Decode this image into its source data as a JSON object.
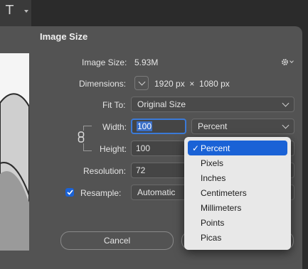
{
  "toolbar": {
    "type_tool_icon": "text-tool-icon",
    "type_tool_glyph": "T"
  },
  "dialog": {
    "title": "Image Size",
    "image_size_label": "Image Size:",
    "image_size_value": "5.93M",
    "dimensions_label": "Dimensions:",
    "dimensions_value": "1920 px  ×  1080 px",
    "fit_to_label": "Fit To:",
    "fit_to_value": "Original Size",
    "width_label": "Width:",
    "width_value": "100",
    "width_unit": "Percent",
    "height_label": "Height:",
    "height_value": "100",
    "resolution_label": "Resolution:",
    "resolution_value": "72",
    "resample_label": "Resample:",
    "resample_checked": true,
    "resample_value": "Automatic",
    "cancel_label": "Cancel"
  },
  "unit_menu": {
    "selected": "Percent",
    "items": [
      "Percent",
      "Pixels",
      "Inches",
      "Centimeters",
      "Millimeters",
      "Points",
      "Picas"
    ]
  },
  "colors": {
    "accent": "#1a62d6",
    "dialog_bg": "#535353",
    "menu_bg": "#e8e8e8"
  }
}
